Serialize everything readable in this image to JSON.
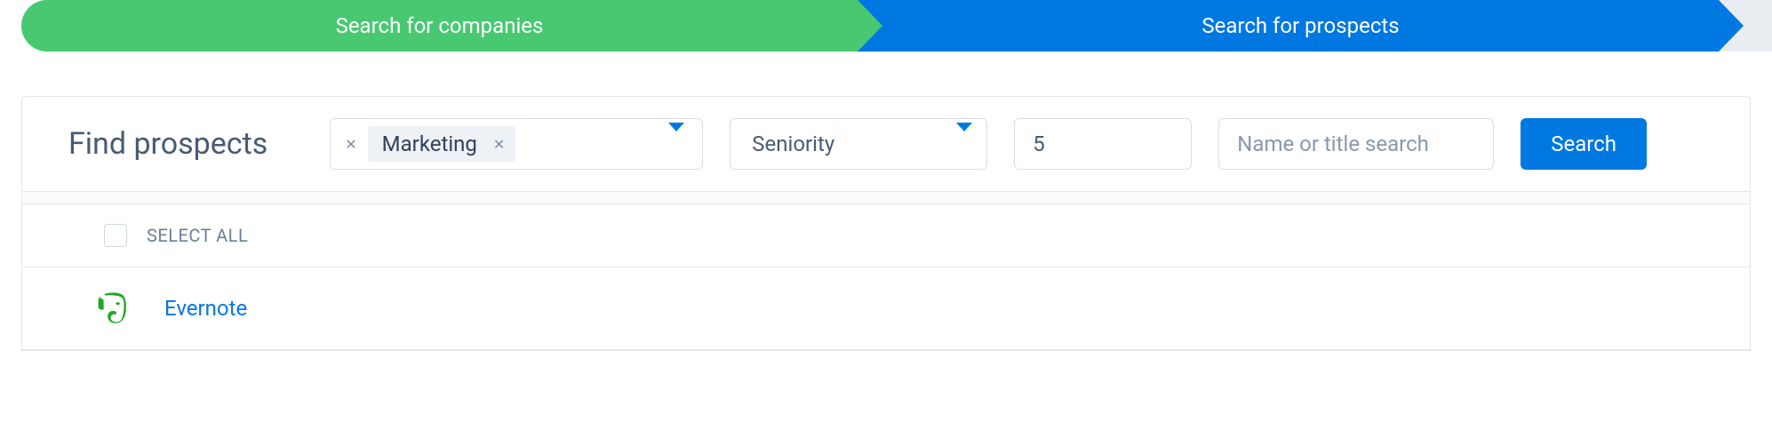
{
  "steps": {
    "step1": "Search for companies",
    "step2": "Search for prospects"
  },
  "filters": {
    "title": "Find prospects",
    "tag_value": "Marketing",
    "seniority_label": "Seniority",
    "count_value": "5",
    "search_placeholder": "Name or title search",
    "search_button": "Search"
  },
  "list": {
    "select_all_label": "SELECT ALL",
    "results": [
      {
        "name": "Evernote"
      }
    ]
  },
  "colors": {
    "green": "#48c971",
    "blue": "#0078e2",
    "evernote_green": "#21a823"
  }
}
